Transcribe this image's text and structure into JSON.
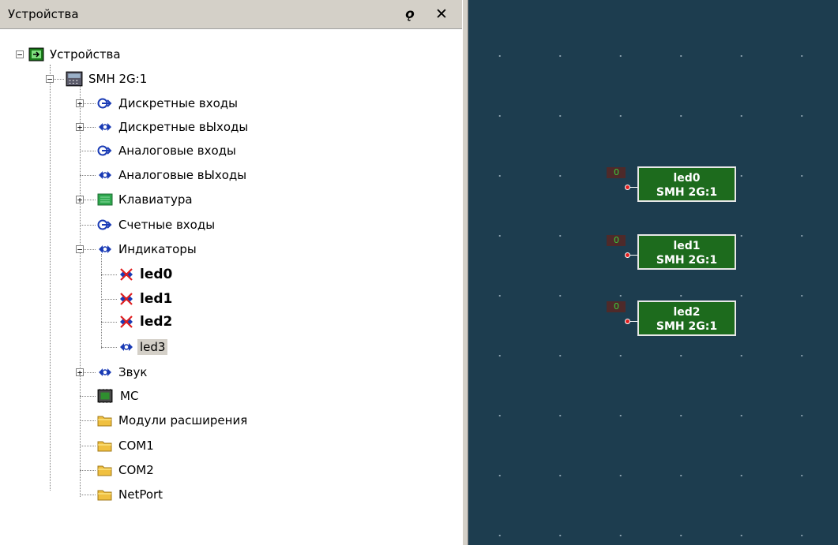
{
  "panel": {
    "title": "Устройства",
    "pin_glyph": "ǫ",
    "close_glyph": "✕"
  },
  "tree": {
    "root": "Устройства",
    "device": "SMH 2G:1",
    "items": [
      {
        "label": "Дискретные входы",
        "icon": "input-arrow-icon"
      },
      {
        "label": "Дискретные вЫходы",
        "icon": "io-diamond-icon"
      },
      {
        "label": "Аналоговые входы",
        "icon": "input-arrow-icon"
      },
      {
        "label": "Аналоговые вЫходы",
        "icon": "io-diamond-icon"
      },
      {
        "label": "Клавиатура",
        "icon": "keyboard-icon"
      },
      {
        "label": "Счетные входы",
        "icon": "input-arrow-icon"
      },
      {
        "label": "Индикаторы",
        "icon": "io-diamond-icon"
      }
    ],
    "leds": [
      "led0",
      "led1",
      "led2",
      "led3"
    ],
    "after": [
      {
        "label": "Звук",
        "icon": "io-diamond-icon"
      },
      {
        "label": "MC",
        "icon": "chip-icon"
      },
      {
        "label": "Модули расширения",
        "icon": "folder-icon"
      },
      {
        "label": "COM1",
        "icon": "folder-icon"
      },
      {
        "label": "COM2",
        "icon": "folder-icon"
      },
      {
        "label": "NetPort",
        "icon": "folder-icon"
      }
    ]
  },
  "canvas": {
    "blocks": [
      {
        "name": "led0",
        "device": "SMH 2G:1",
        "value": "0"
      },
      {
        "name": "led1",
        "device": "SMH 2G:1",
        "value": "0"
      },
      {
        "name": "led2",
        "device": "SMH 2G:1",
        "value": "0"
      }
    ]
  },
  "colors": {
    "canvas_bg": "#1d3d4f",
    "block_fill": "#1d6b1d",
    "pin": "#e02020",
    "value_text": "#3cd23c"
  }
}
